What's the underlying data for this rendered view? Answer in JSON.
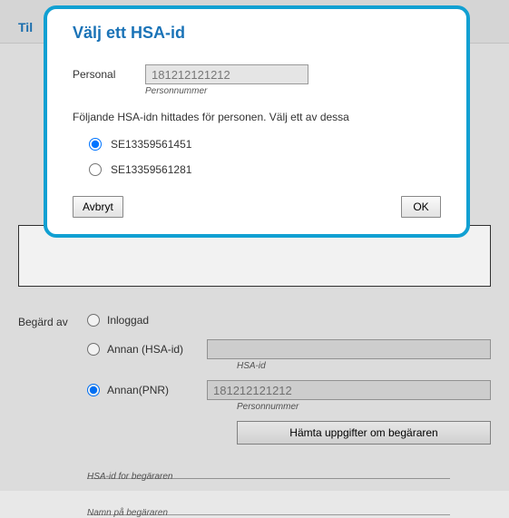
{
  "background": {
    "header_title_fragment": "Til",
    "begard_av_label": "Begärd av",
    "radios": {
      "inloggad": "Inloggad",
      "annan_hsa": "Annan (HSA-id)",
      "annan_pnr": "Annan(PNR)"
    },
    "hsa_field": {
      "value": "",
      "caption": "HSA-id"
    },
    "pnr_field": {
      "value": "181212121212",
      "caption": "Personnummer"
    },
    "fetch_button": "Hämta uppgifter om begäraren",
    "value_rows": {
      "hsa_begararen": "HSA-id for begäraren",
      "namn_begararen": "Namn på begäraren"
    }
  },
  "modal": {
    "title": "Välj ett HSA-id",
    "personal_label": "Personal",
    "personal_value": "181212121212",
    "personal_caption": "Personnummer",
    "instruction": "Följande HSA-idn hittades för personen. Välj ett av dessa",
    "options": [
      "SE13359561451",
      "SE13359561281"
    ],
    "cancel": "Avbryt",
    "ok": "OK"
  }
}
